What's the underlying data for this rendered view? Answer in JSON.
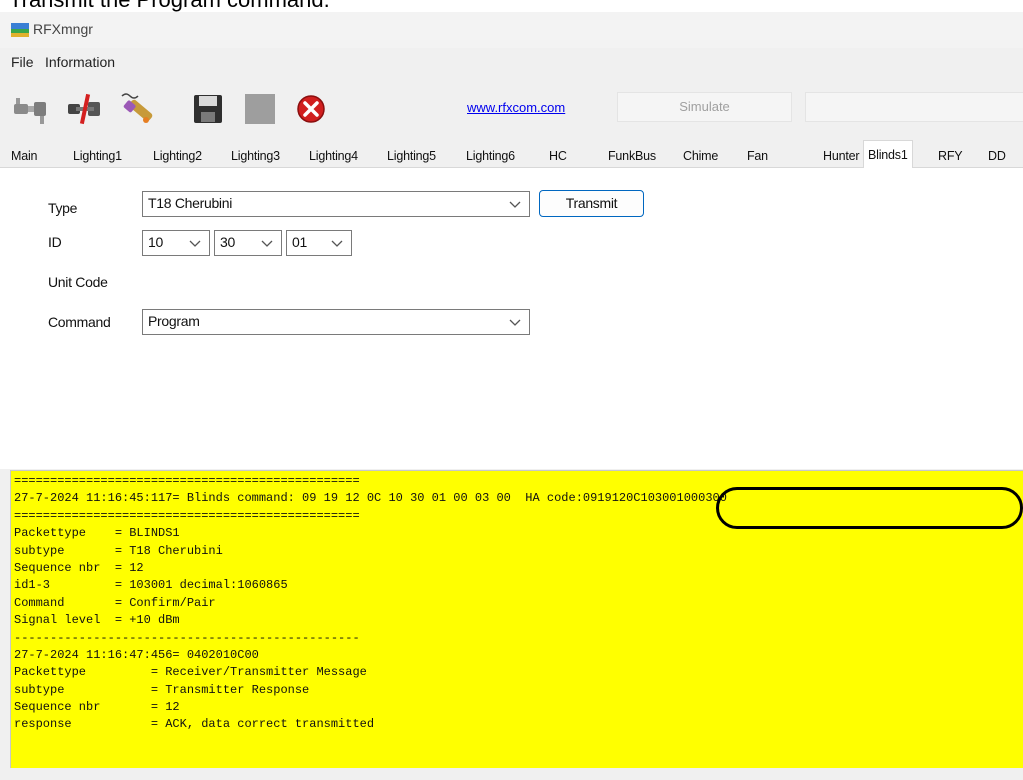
{
  "caption": "Transmit the Program command.",
  "app_title": "RFXmngr",
  "menu": [
    "File",
    "Information"
  ],
  "toolbar": {
    "icons": [
      "connect-icon",
      "disconnect-icon",
      "firmware-icon",
      "save-icon",
      "stop-icon",
      "close-icon"
    ],
    "link": "www.rfxcom.com",
    "simulate": "Simulate"
  },
  "tabs": [
    "Main",
    "Lighting1",
    "Lighting2",
    "Lighting3",
    "Lighting4",
    "Lighting5",
    "Lighting6",
    "HC",
    "FunkBus",
    "Chime",
    "Fan",
    "Hunter",
    "Blinds1",
    "RFY",
    "DD"
  ],
  "active_tab": "Blinds1",
  "form": {
    "type_label": "Type",
    "type_value": "T18 Cherubini",
    "transmit": "Transmit",
    "id_label": "ID",
    "id_values": [
      "10",
      "30",
      "01"
    ],
    "unit_code_label": "Unit Code",
    "command_label": "Command",
    "command_value": "Program"
  },
  "log_lines": [
    "================================================",
    "27-7-2024 11:16:45:117= Blinds command: 09 19 12 0C 10 30 01 00 03 00  HA code:0919120C103001000300",
    "================================================",
    "Packettype    = BLINDS1",
    "subtype       = T18 Cherubini",
    "Sequence nbr  = 12",
    "id1-3         = 103001 decimal:1060865",
    "Command       = Confirm/Pair",
    "Signal level  = +10 dBm",
    "------------------------------------------------",
    "27-7-2024 11:16:47:456= 0402010C00",
    "Packettype         = Receiver/Transmitter Message",
    "subtype            = Transmitter Response",
    "Sequence nbr       = 12",
    "response           = ACK, data correct transmitted"
  ]
}
